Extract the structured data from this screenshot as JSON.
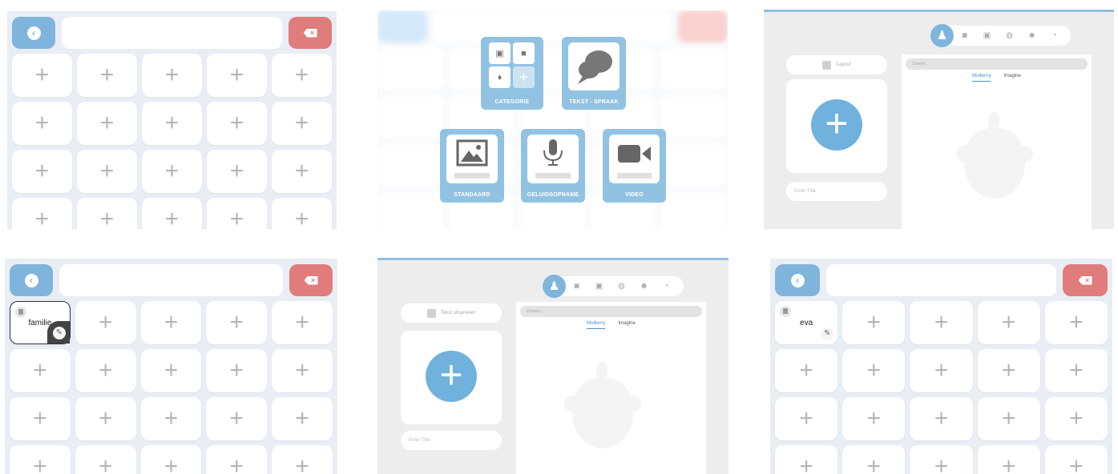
{
  "grid": {
    "back_icon": "chevron-left-icon",
    "delete_icon": "backspace-icon",
    "delete_glyph": "×",
    "plus_glyph": "+",
    "colors": {
      "accent": "#7fb5dc",
      "danger": "#e07c7c",
      "background": "#e9eef5"
    }
  },
  "screen4": {
    "filled_label": "familie"
  },
  "screen6": {
    "filled_label": "eva"
  },
  "type_menu": {
    "items": [
      {
        "label": "CATEGORIE"
      },
      {
        "label": "TEKST - SPRAAK"
      },
      {
        "label": "STANDAARD"
      },
      {
        "label": "GELUIDSOPNAME"
      },
      {
        "label": "VIDEO"
      }
    ]
  },
  "editor1": {
    "layout_label": "Layout",
    "title_placeholder": "Enter Title",
    "search_placeholder": "Zoeken...",
    "tabs": [
      "Mulberry",
      "Imagine"
    ]
  },
  "editor2": {
    "speak_label": "Tekst uitspreken",
    "title_placeholder": "Enter Title",
    "search_placeholder": "Zoeken...",
    "tabs": [
      "Mulberry",
      "Imagine"
    ]
  },
  "category_icons": [
    "person-icon",
    "camera-icon",
    "image-icon",
    "globe-icon",
    "smiley-icon",
    "palette-icon"
  ]
}
